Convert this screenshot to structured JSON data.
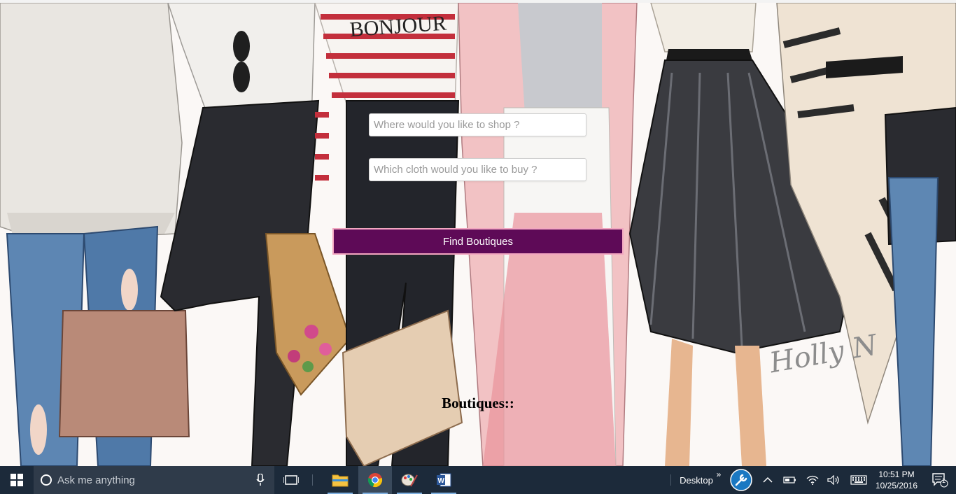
{
  "form": {
    "shop_placeholder": "Where would you like to shop ?",
    "cloth_placeholder": "Which cloth would you like to buy ?",
    "find_button_label": "Find Boutiques",
    "results_heading": "Boutiques::"
  },
  "background": {
    "shirt_text": "BONJOUR",
    "signature": "Holly N"
  },
  "taskbar": {
    "search_placeholder": "Ask me anything",
    "apps": [
      "file-explorer",
      "chrome",
      "paint",
      "word"
    ],
    "desktop_label": "Desktop",
    "time": "10:51 PM",
    "date": "10/25/2016",
    "notification_count": "1"
  },
  "colors": {
    "button_bg": "#5e0a57",
    "button_border": "#f2a6c0",
    "taskbar_bg": "#1c2a3a"
  }
}
